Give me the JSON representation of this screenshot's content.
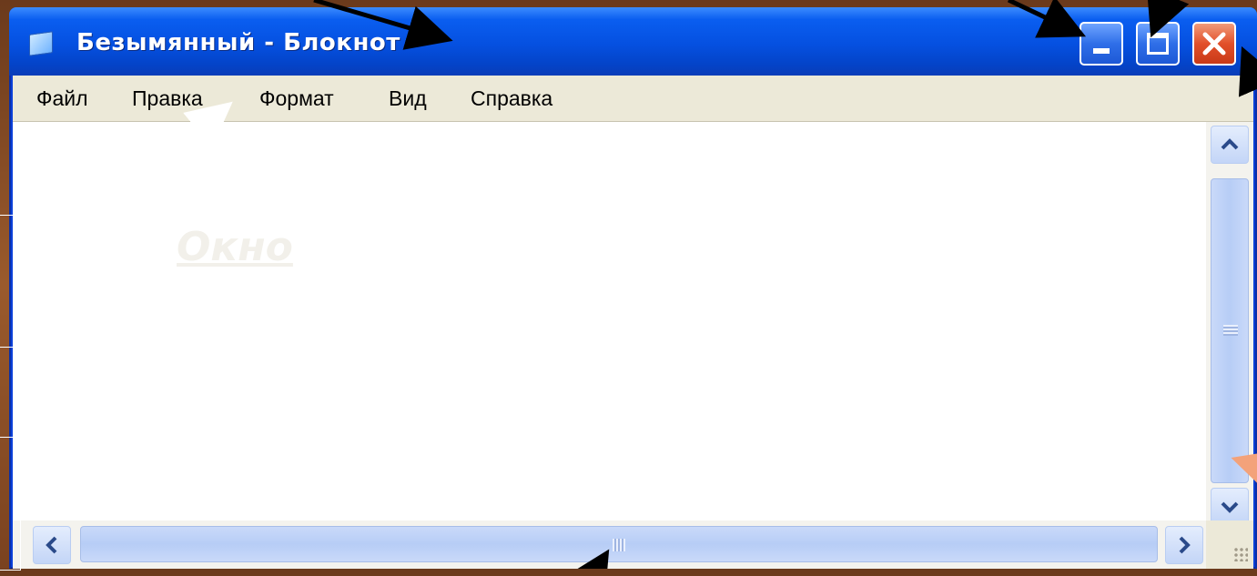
{
  "window": {
    "title": "Безымянный - Блокнот",
    "icon": "notepad-icon",
    "controls": {
      "minimize_icon": "minimize-icon",
      "maximize_icon": "maximize-icon",
      "close_icon": "close-icon"
    }
  },
  "menu": {
    "items": [
      {
        "label": "Файл"
      },
      {
        "label": "Правка"
      },
      {
        "label": "Формат"
      },
      {
        "label": "Вид"
      },
      {
        "label": "Справка"
      }
    ]
  },
  "editor": {
    "watermark": "Окно "
  },
  "scrollbars": {
    "up_icon": "chevron-up-icon",
    "down_icon": "chevron-down-icon",
    "left_icon": "chevron-left-icon",
    "right_icon": "chevron-right-icon"
  },
  "colors": {
    "titlebar": "#0550e0",
    "close_button": "#e2502a",
    "menubar": "#ece9d8",
    "scrollbar_thumb": "#b7cdf6"
  }
}
